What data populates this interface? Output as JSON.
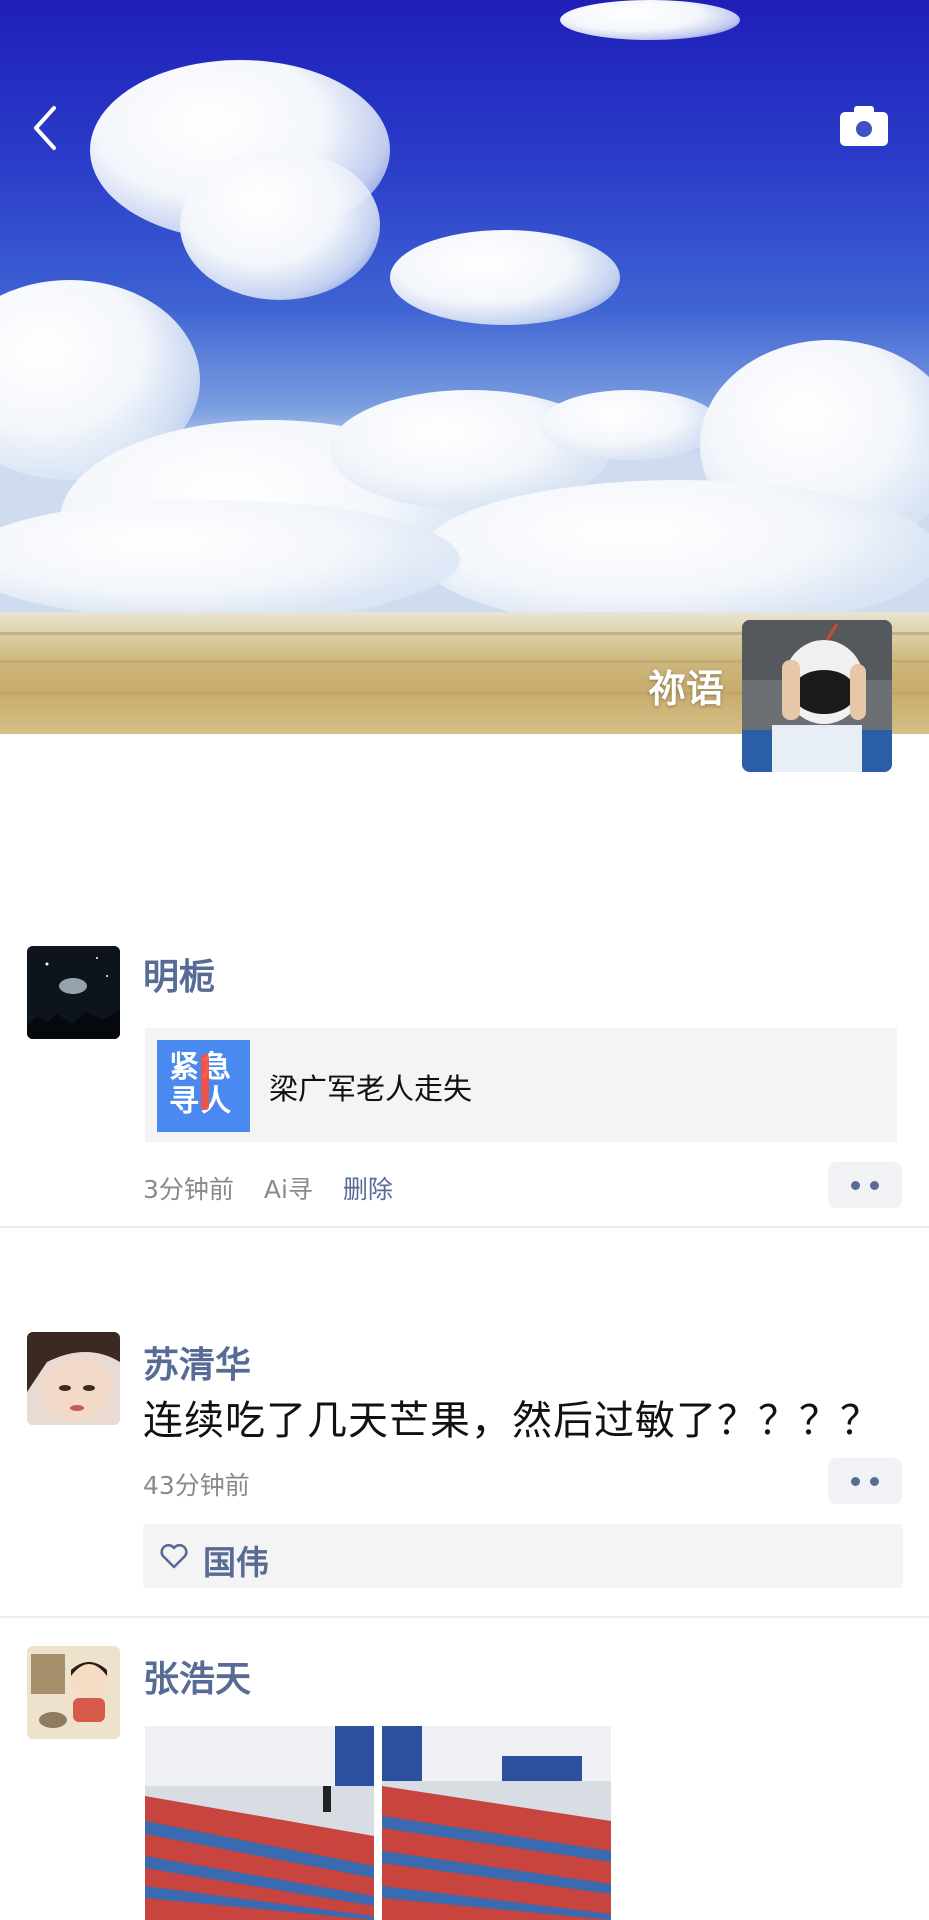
{
  "cover": {
    "name": "祢语",
    "back_icon": "chevron-left-icon",
    "camera_icon": "camera-icon"
  },
  "feed": [
    {
      "author": "明栀",
      "link": {
        "thumb_line1": "紧急",
        "thumb_line2": "寻人",
        "title": "梁广军老人走失"
      },
      "time": "3分钟前",
      "source": "Ai寻",
      "delete_label": "删除"
    },
    {
      "author": "苏清华",
      "text": "连续吃了几天芒果，然后过敏了？？？？",
      "time": "43分钟前",
      "likes": [
        "国伟"
      ]
    },
    {
      "author": "张浩天"
    }
  ],
  "colors": {
    "author_blue": "#576b95",
    "meta_gray": "#8a8a8a",
    "card_bg": "#f4f4f4",
    "thumb_blue": "#4a8af0"
  }
}
